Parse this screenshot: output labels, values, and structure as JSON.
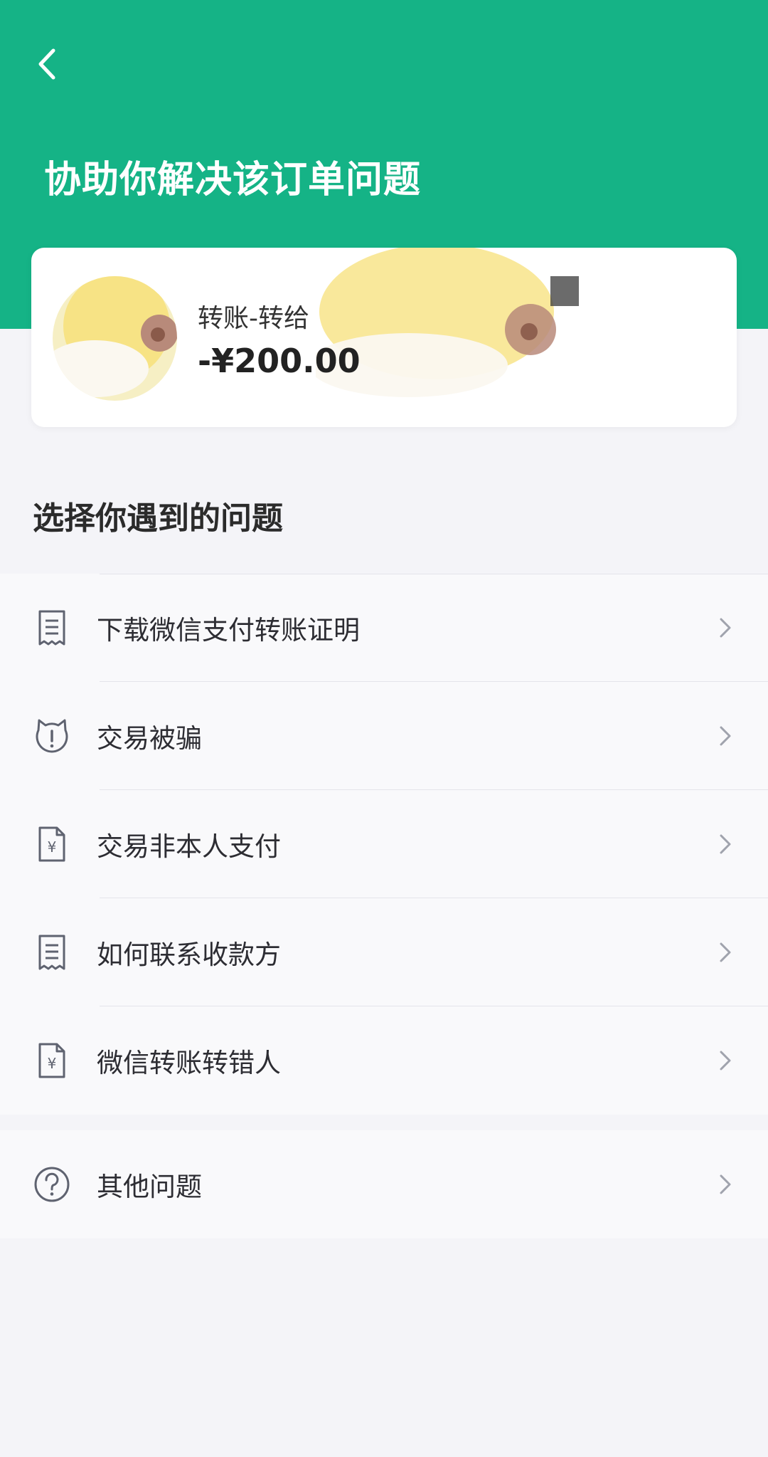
{
  "header": {
    "title": "协助你解决该订单问题",
    "back_icon": "chevron-left-icon",
    "bg_color": "#15b386"
  },
  "order": {
    "title": "转账-转给",
    "amount": "-¥200.00"
  },
  "section": {
    "title": "选择你遇到的问题"
  },
  "issues": [
    {
      "label": "下载微信支付转账证明",
      "icon": "receipt-icon"
    },
    {
      "label": "交易被骗",
      "icon": "alert-shield-icon"
    },
    {
      "label": "交易非本人支付",
      "icon": "yuan-document-icon"
    },
    {
      "label": "如何联系收款方",
      "icon": "receipt-icon"
    },
    {
      "label": "微信转账转错人",
      "icon": "yuan-document-icon"
    }
  ],
  "other": {
    "label": "其他问题",
    "icon": "question-circle-icon"
  }
}
